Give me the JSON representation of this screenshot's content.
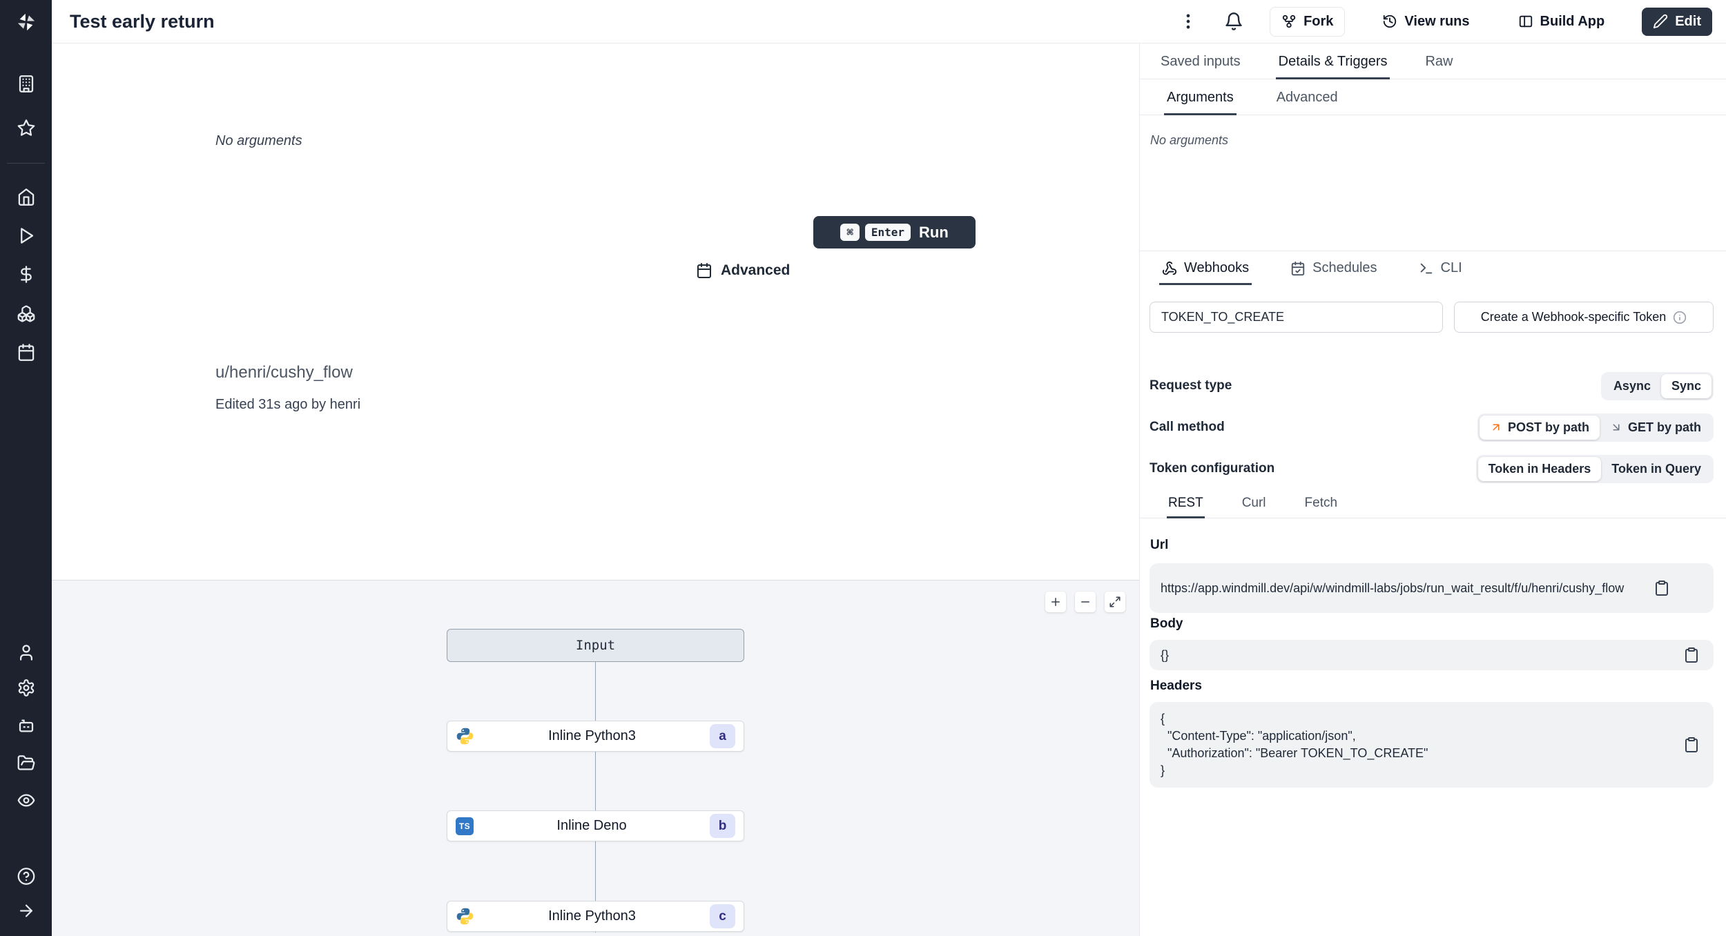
{
  "topbar": {
    "title": "Test early return",
    "fork_label": "Fork",
    "view_runs_label": "View runs",
    "build_app_label": "Build App",
    "edit_label": "Edit"
  },
  "sidebar": {
    "icons": [
      "windmill-logo",
      "buildings-icon",
      "star-icon",
      "home-icon",
      "play-icon",
      "dollar-icon",
      "boxes-icon",
      "calendar-icon",
      "user-icon",
      "settings-gear-icon",
      "robot-icon",
      "folder-open-icon",
      "eye-icon",
      "help-circle-icon",
      "arrow-right-icon"
    ]
  },
  "runner": {
    "no_arguments": "No arguments",
    "advanced_label": "Advanced",
    "run_label": "Run",
    "shortcut_keys": [
      "⌘",
      "Enter"
    ]
  },
  "flow": {
    "path": "u/henri/cushy_flow",
    "edited_info": "Edited 31s ago by henri",
    "graph": {
      "input_label": "Input",
      "nodes": [
        {
          "label": "Inline Python3",
          "badge": "a",
          "language": "python"
        },
        {
          "label": "Inline Deno",
          "badge": "b",
          "language": "typescript"
        },
        {
          "label": "Inline Python3",
          "badge": "c",
          "language": "python"
        }
      ]
    }
  },
  "logos": {
    "typescript": "TS"
  },
  "panel": {
    "tabs": [
      "Saved inputs",
      "Details & Triggers",
      "Raw"
    ],
    "active_tab": "Details & Triggers",
    "subtabs": [
      "Arguments",
      "Advanced"
    ],
    "active_subtab": "Arguments",
    "no_arguments": "No arguments",
    "trigger_tabs": [
      "Webhooks",
      "Schedules",
      "CLI"
    ],
    "active_trigger_tab": "Webhooks",
    "token_field": {
      "value": "TOKEN_TO_CREATE"
    },
    "create_token_button": "Create a Webhook-specific Token",
    "settings": [
      {
        "label": "Request type",
        "options": [
          "Async",
          "Sync"
        ],
        "selected": "Sync"
      },
      {
        "label": "Call method",
        "options": [
          "POST by path",
          "GET by path"
        ],
        "selected": "POST by path"
      },
      {
        "label": "Token configuration",
        "options": [
          "Token in Headers",
          "Token in Query"
        ],
        "selected": "Token in Headers"
      }
    ],
    "code_tabs": [
      "REST",
      "Curl",
      "Fetch"
    ],
    "active_code_tab": "REST",
    "url_section": {
      "label": "Url",
      "value": "https://app.windmill.dev/api/w/windmill-labs/jobs/run_wait_result/f/u/henri/cushy_flow"
    },
    "body_section": {
      "label": "Body",
      "value": "{}"
    },
    "headers_section": {
      "label": "Headers",
      "value": "{\n  \"Content-Type\": \"application/json\",\n  \"Authorization\": \"Bearer TOKEN_TO_CREATE\"\n}"
    }
  },
  "colors": {
    "sidebar_bg": "#1d222e",
    "dark_button": "#2b3442",
    "accent_orange": "#f97316",
    "badge_bg": "#dfe4fb",
    "badge_text": "#312e81",
    "canvas_bg": "#f4f5f8"
  }
}
